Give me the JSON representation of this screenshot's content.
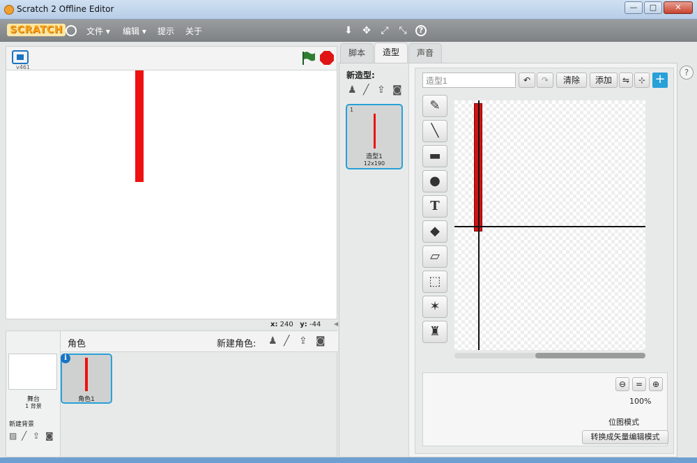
{
  "window": {
    "title": "Scratch 2 Offline Editor",
    "minimize": "—",
    "maximize": "□",
    "close": "✕"
  },
  "menubar": {
    "logo": "SCRATCH",
    "items": [
      {
        "label": "文件 ▾"
      },
      {
        "label": "编辑 ▾"
      },
      {
        "label": "提示"
      },
      {
        "label": "关于"
      }
    ],
    "tools": [
      {
        "icon": "stamp-tool-icon",
        "glyph": "⬇"
      },
      {
        "icon": "cut-tool-icon",
        "glyph": "✥"
      },
      {
        "icon": "grow-tool-icon",
        "glyph": "⤢"
      },
      {
        "icon": "shrink-tool-icon",
        "glyph": "⤡"
      },
      {
        "icon": "help-tool-icon",
        "glyph": "?"
      }
    ]
  },
  "stage": {
    "version": "v461",
    "coords": {
      "x_label": "x:",
      "x": "240",
      "y_label": "y:",
      "y": "-44"
    }
  },
  "sprites": {
    "header": "角色",
    "new_sprite": "新建角色:",
    "stage_name": "舞台",
    "stage_bg_count": "1 背景",
    "new_backdrop": "新建背景",
    "sprite_name": "角色1"
  },
  "tabs": [
    {
      "label": "脚本"
    },
    {
      "label": "造型"
    },
    {
      "label": "声音"
    }
  ],
  "costumes": {
    "new_costume": "新造型:",
    "items": [
      {
        "index": "1",
        "name": "造型1",
        "size": "12x190"
      }
    ]
  },
  "editor": {
    "costume_name": "造型1",
    "clear": "清除",
    "add": "添加",
    "zoom": "100%",
    "mode": "位图模式",
    "convert": "转换成矢量编辑模式"
  },
  "colors": {
    "accent": "#28a0d8",
    "sprite": "#ee1111",
    "stop": "#e01414",
    "flag": "#2e7d32"
  }
}
